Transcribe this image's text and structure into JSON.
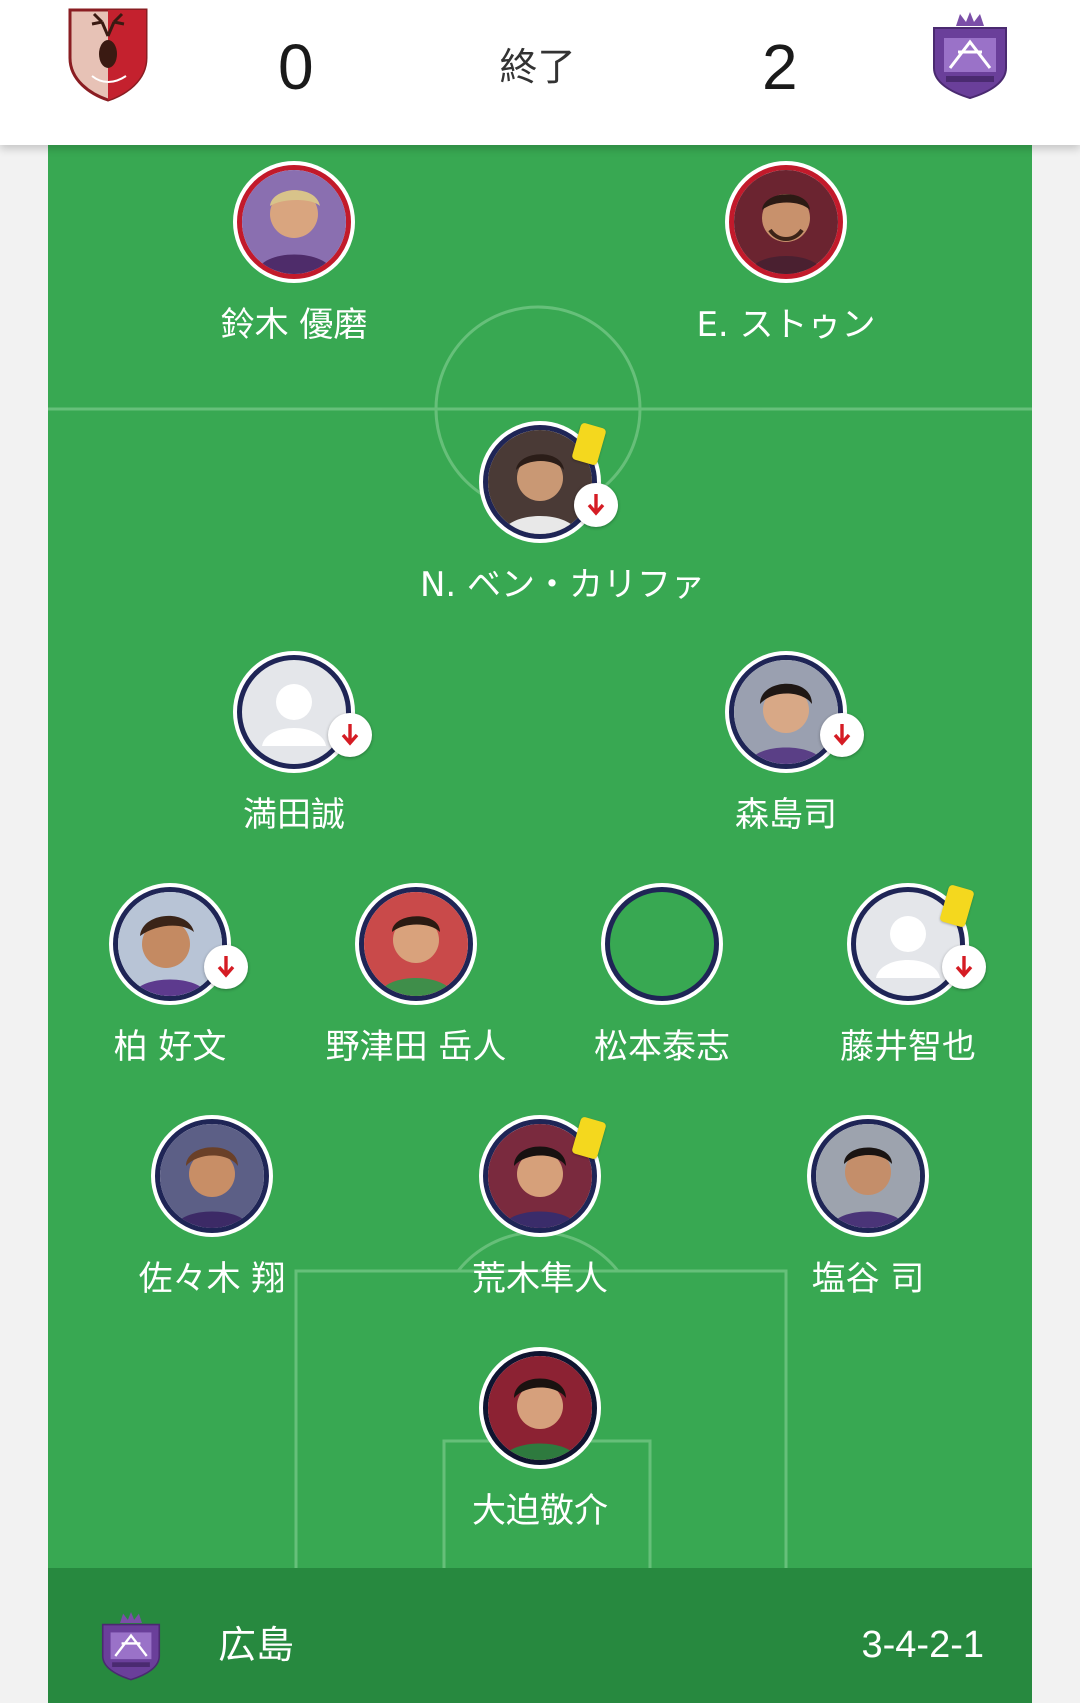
{
  "match": {
    "home_score": "0",
    "away_score": "2",
    "status": "終了",
    "home_crest_icon": "antlers-crest-icon",
    "away_crest_icon": "sanfrecce-crest-icon"
  },
  "players": [
    {
      "name": "鈴木 優磨",
      "photo": true,
      "border": "red",
      "substituted": false,
      "yellow_card": false
    },
    {
      "name": "E. ストゥン",
      "photo": true,
      "border": "red",
      "substituted": false,
      "yellow_card": false
    },
    {
      "name": "N. ベン・カリファ",
      "photo": true,
      "border": "navy",
      "substituted": true,
      "yellow_card": true
    },
    {
      "name": "満田誠",
      "photo": false,
      "border": "navy",
      "substituted": true,
      "yellow_card": false
    },
    {
      "name": "森島司",
      "photo": true,
      "border": "navy",
      "substituted": true,
      "yellow_card": false
    },
    {
      "name": "柏 好文",
      "photo": true,
      "border": "navy",
      "substituted": true,
      "yellow_card": false
    },
    {
      "name": "野津田 岳人",
      "photo": true,
      "border": "navy",
      "substituted": false,
      "yellow_card": false
    },
    {
      "name": "松本泰志",
      "photo": false,
      "border": "navy",
      "substituted": false,
      "yellow_card": false
    },
    {
      "name": "藤井智也",
      "photo": false,
      "border": "navy",
      "substituted": true,
      "yellow_card": true
    },
    {
      "name": "佐々木 翔",
      "photo": true,
      "border": "navy",
      "substituted": false,
      "yellow_card": false
    },
    {
      "name": "荒木隼人",
      "photo": true,
      "border": "navy",
      "substituted": false,
      "yellow_card": true
    },
    {
      "name": "塩谷 司",
      "photo": true,
      "border": "navy",
      "substituted": false,
      "yellow_card": false
    },
    {
      "name": "大迫敬介",
      "photo": true,
      "border": "dark",
      "substituted": false,
      "yellow_card": false
    }
  ],
  "footer": {
    "team_name": "広島",
    "formation": "3-4-2-1"
  },
  "colors": {
    "pitch": "#38a852",
    "footer": "#27893f",
    "home_ring": "#c21a2b",
    "away_ring": "#1f2556",
    "yellow_card": "#f4d81e",
    "sub_arrow": "#d51c24"
  }
}
